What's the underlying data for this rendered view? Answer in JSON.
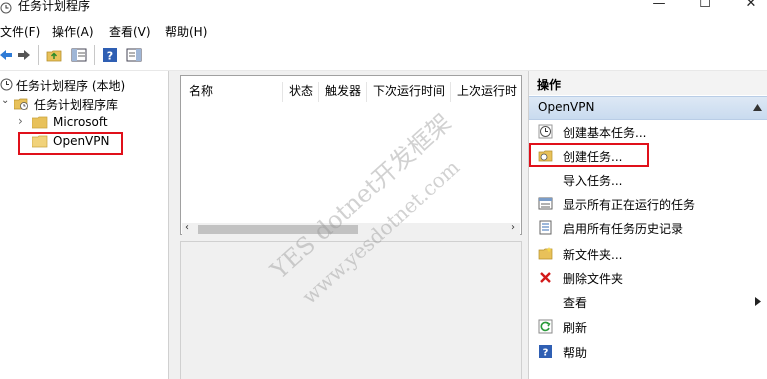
{
  "window": {
    "title": "任务计划程序",
    "controls": [
      "—",
      "☐",
      "✕"
    ]
  },
  "menu": {
    "items": [
      "文件(F)",
      "操作(A)",
      "查看(V)",
      "帮助(H)"
    ]
  },
  "tree": {
    "root": "任务计划程序 (本地)",
    "library": "任务计划程序库",
    "children": [
      "Microsoft",
      "OpenVPN"
    ],
    "selected": "OpenVPN"
  },
  "task_list": {
    "columns": [
      "名称",
      "状态",
      "触发器",
      "下次运行时间",
      "上次运行时"
    ]
  },
  "actions_pane": {
    "header": "操作",
    "section": "OpenVPN",
    "items": [
      {
        "label": "创建基本任务...",
        "icon": "clock-icon"
      },
      {
        "label": "创建任务...",
        "icon": "folder-clock-icon"
      },
      {
        "label": "导入任务...",
        "icon": "none"
      },
      {
        "label": "显示所有正在运行的任务",
        "icon": "list-icon"
      },
      {
        "label": "启用所有任务历史记录",
        "icon": "history-icon"
      },
      {
        "label": "新文件夹...",
        "icon": "folder-icon"
      },
      {
        "label": "删除文件夹",
        "icon": "delete-icon"
      },
      {
        "label": "查看",
        "icon": "none"
      },
      {
        "label": "刷新",
        "icon": "refresh-icon"
      },
      {
        "label": "帮助",
        "icon": "help-icon"
      }
    ]
  },
  "watermark": {
    "line1": "YES dotnet开发框架",
    "line2": "www.yesdotnet.com"
  },
  "colors": {
    "highlight": "#e0101a",
    "section_header": "#c9dbef",
    "folder": "#e8c15a"
  }
}
